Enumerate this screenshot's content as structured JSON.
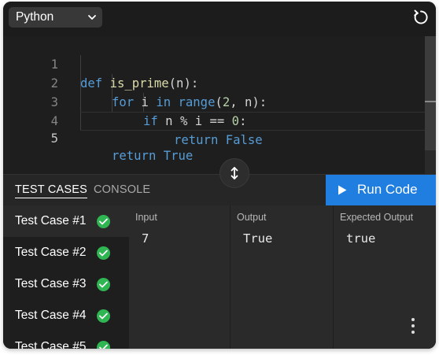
{
  "toolbar": {
    "language": "Python"
  },
  "editor": {
    "lines": [
      {
        "n": "1"
      },
      {
        "n": "2"
      },
      {
        "n": "3"
      },
      {
        "n": "4"
      },
      {
        "n": "5"
      }
    ],
    "tokens": {
      "l1_def": "def",
      "l1_name": "is_prime",
      "l1_rest": "(n):",
      "l2_for": "for",
      "l2_i": " i ",
      "l2_in": "in",
      "l2_range": "range",
      "l2_open": "(",
      "l2_two": "2",
      "l2_rest": ", n):",
      "l3_if": "if",
      "l3_mid": " n % i == ",
      "l3_zero": "0",
      "l3_colon": ":",
      "l4_return": "return",
      "l4_false": "False",
      "l5_return": "return",
      "l5_true": "True"
    }
  },
  "tabs": {
    "test_cases": "TEST CASES",
    "console": "CONSOLE",
    "run_code": "Run Code"
  },
  "test_cases": [
    {
      "label": "Test Case #1"
    },
    {
      "label": "Test Case #2"
    },
    {
      "label": "Test Case #3"
    },
    {
      "label": "Test Case #4"
    },
    {
      "label": "Test Case #5"
    }
  ],
  "io": {
    "input_header": "Input",
    "output_header": "Output",
    "expected_header": "Expected Output",
    "input_value": "7",
    "output_value": "True",
    "expected_value": "true"
  },
  "colors": {
    "accent": "#1f7ee0",
    "pass": "#2fb552",
    "background": "#1e1e1e"
  },
  "icons": [
    "chevron-down-icon",
    "reset-icon",
    "resize-vertical-icon",
    "play-icon",
    "check-circle-icon",
    "more-vertical-icon"
  ]
}
